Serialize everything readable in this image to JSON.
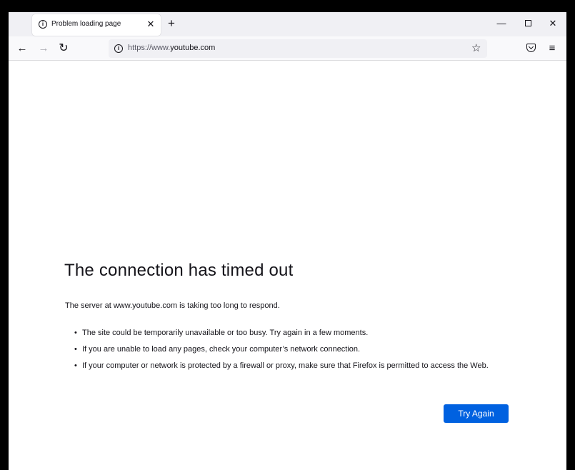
{
  "tab": {
    "title": "Problem loading page",
    "info_icon": "info-icon",
    "close_symbol": "✕",
    "new_tab_symbol": "+"
  },
  "window_controls": {
    "minimize": "—",
    "close": "✕"
  },
  "navbar": {
    "back": "←",
    "forward": "→",
    "reload": "↻",
    "url_prefix": "https://www.",
    "url_domain": "youtube.com",
    "bookmark_star": "☆",
    "menu": "≡"
  },
  "error": {
    "title": "The connection has timed out",
    "description": "The server at www.youtube.com is taking too long to respond.",
    "bullets": [
      "The site could be temporarily unavailable or too busy. Try again in a few moments.",
      "If you are unable to load any pages, check your computer’s network connection.",
      "If your computer or network is protected by a firewall or proxy, make sure that Firefox is permitted to access the Web."
    ],
    "button_label": "Try Again"
  },
  "colors": {
    "accent": "#0061e0",
    "tabstrip_bg": "#f0f0f4",
    "text": "#15141a"
  }
}
